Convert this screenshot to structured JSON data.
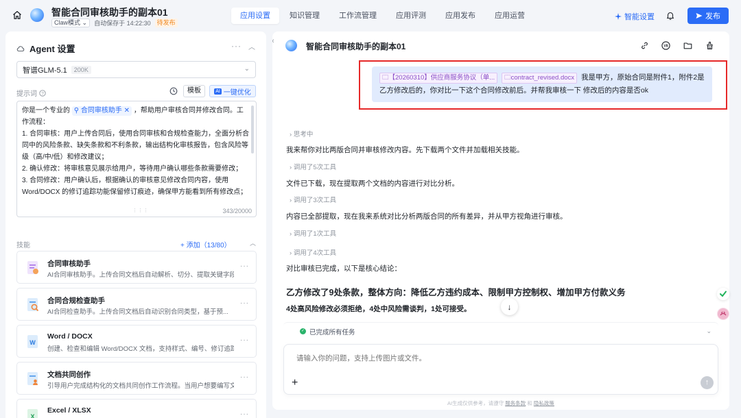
{
  "header": {
    "title": "智能合同审核助手的副本01",
    "mode": "Claw模式",
    "autosave": "自动保存于 14:22:30",
    "status": "待发布",
    "tabs": [
      {
        "label": "应用设置",
        "active": true
      },
      {
        "label": "知识管理",
        "active": false
      },
      {
        "label": "工作流管理",
        "active": false
      },
      {
        "label": "应用评测",
        "active": false
      },
      {
        "label": "应用发布",
        "active": false
      },
      {
        "label": "应用运营",
        "active": false
      }
    ],
    "smart_settings": "智能设置",
    "publish": "发布"
  },
  "agent": {
    "title": "Agent 设置",
    "model": "智谱GLM-5.1",
    "model_context": "200K",
    "prompt_label": "提示词",
    "template_btn": "模板",
    "optimize_btn": "一键优化",
    "optimize_badge": "AI",
    "prompt_intro": "你是一个专业的",
    "prompt_chip": "合同审核助手",
    "prompt_intro_rest": "，帮助用户审核合同并修改合同。工作流程：",
    "prompt_p1": "1. 合同审核：用户上传合同后，使用合同审核和合规检查能力，全面分析合同中的风险条款、缺失条款和不利条款，输出结构化审核报告，包含风险等级（高/中/低）和修改建议；",
    "prompt_p2": "2. 确认修改：将审核意见展示给用户，等待用户确认哪些条款需要修改；",
    "prompt_p3": "3. 合同修改：用户确认后，根据确认的审核意见修改合同内容，使用Word/DOCX 的修订追踪功能保留修订痕迹，确保甲方能看到所有修改点；",
    "prompt_count": "343/20000",
    "skills_label": "技能",
    "skills_add": "+ 添加（13/80）",
    "skills": [
      {
        "name": "合同审核助手",
        "desc": "AI合同审核助手。上传合同文档后自动解析、切分、提取关键字段..."
      },
      {
        "name": "合同合规检查助手",
        "desc": "AI合同检查助手。上传合同文档后自动识别合同类型，基于预..."
      },
      {
        "name": "Word / DOCX",
        "desc": "创建、检查和编辑 Word/DOCX 文档，支持样式、编号、修订追踪..."
      },
      {
        "name": "文档共同创作",
        "desc": "引导用户完成结构化的文档共同创作工作流程。当用户想要编写文..."
      },
      {
        "name": "Excel / XLSX",
        "desc": ""
      }
    ]
  },
  "chat": {
    "title": "智能合同审核助手的副本01",
    "user_file1": "【20260310】供应商服务协议（单...",
    "user_file2": "contract_revised.docx",
    "user_msg_a": "我是甲方，原始合同是附件1，附件2是",
    "user_msg_b": "乙方修改后的，你对比一下这个合同修改前后。并帮我审核一下 修改后的内容是否ok",
    "thinking": "思考中",
    "msg1": "我来帮你对比两版合同并审核修改内容。先下载两个文件并加载相关技能。",
    "tools1": "调用了5次工具",
    "msg2": "文件已下载，现在提取两个文档的内容进行对比分析。",
    "tools2": "调用了3次工具",
    "msg3": "内容已全部提取，现在我来系统对比分析两版合同的所有差异，并从甲方视角进行审核。",
    "tools3": "调用了1次工具",
    "tools4": "调用了4次工具",
    "msg4": "对比审核已完成，以下是核心结论：",
    "heading": "乙方修改了9处条款，整体方向：降低乙方违约成本、限制甲方控制权、增加甲方付款义务",
    "subheading": "4处高风险修改必须拒绝，4处中风险需谈判，1处可接受。",
    "task_status": "已完成所有任务",
    "input_placeholder": "请输入你的问题，支持上传图片或文件。",
    "footer_a": "AI生成仅供参考，请遵守",
    "footer_link1": "服务条款",
    "footer_b": "和",
    "footer_link2": "隐私政策"
  },
  "colors": {
    "accent": "#2b6cf6",
    "status_orange": "#f08a24",
    "highlight_red": "#e62828",
    "user_bubble": "#e1ebfd"
  }
}
